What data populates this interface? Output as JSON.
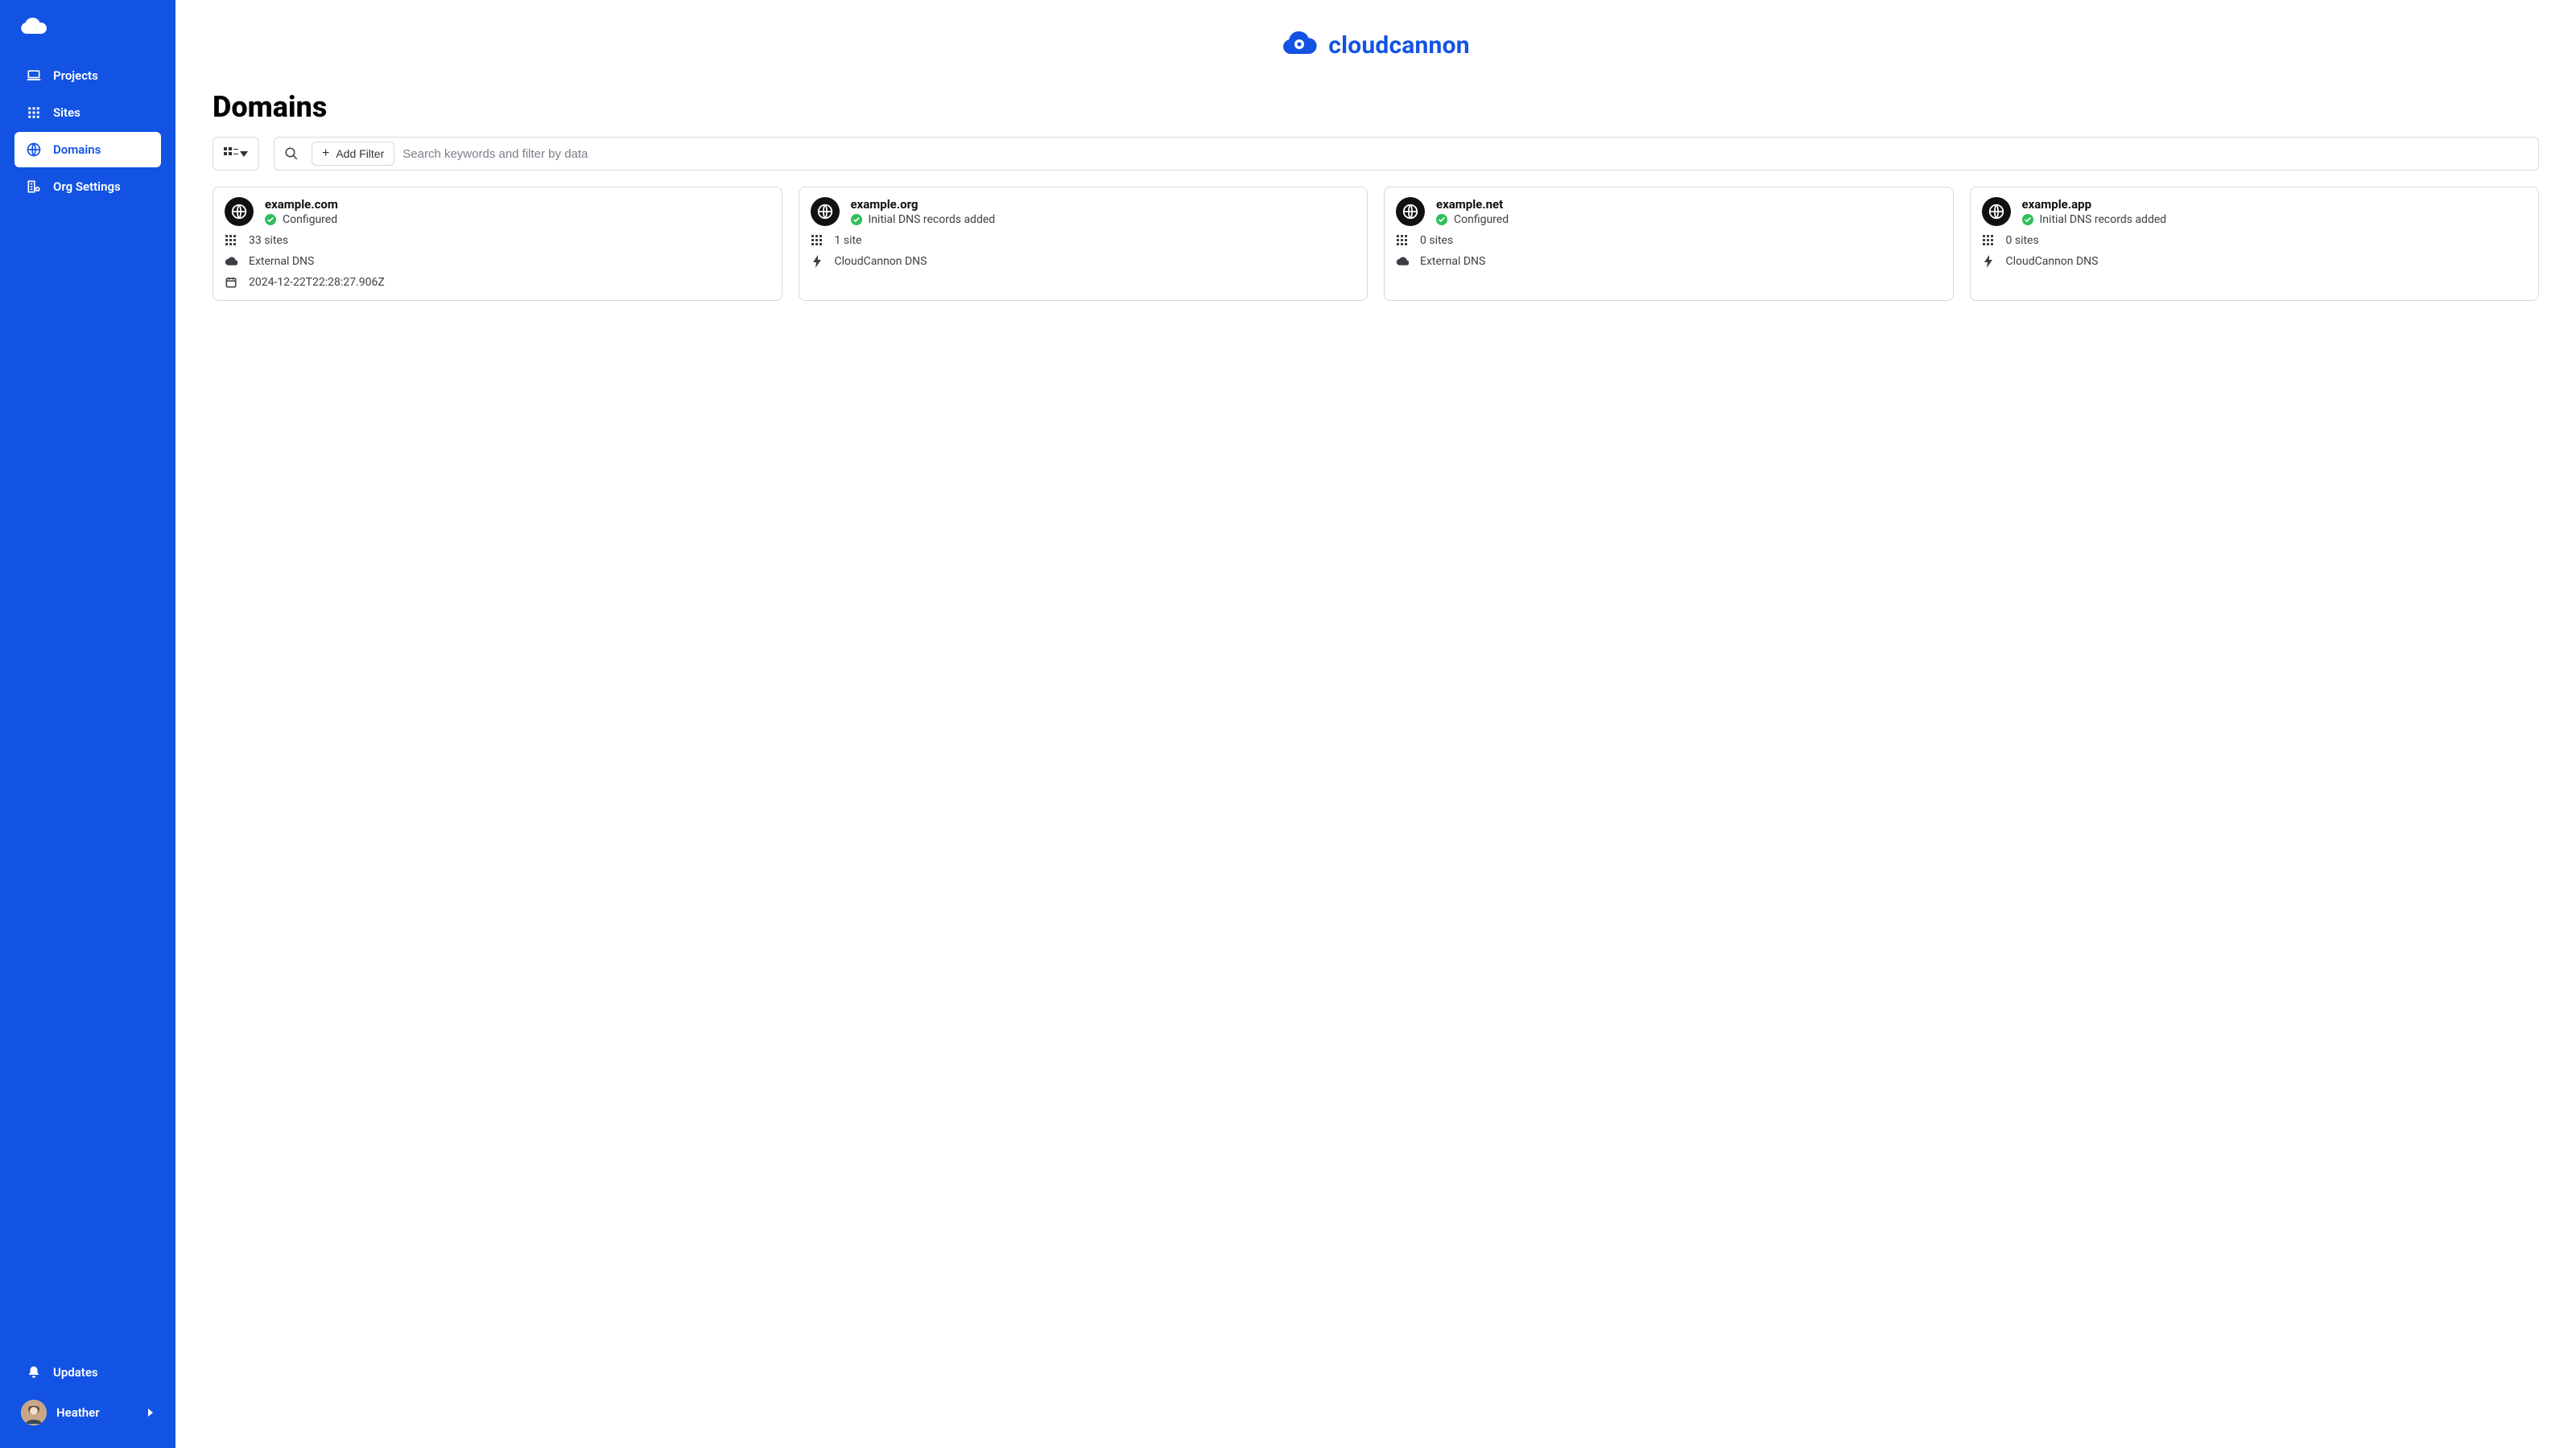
{
  "brand": {
    "name": "cloudcannon"
  },
  "sidebar": {
    "items": [
      {
        "label": "Projects"
      },
      {
        "label": "Sites"
      },
      {
        "label": "Domains"
      },
      {
        "label": "Org Settings"
      }
    ],
    "updates_label": "Updates",
    "user_name": "Heather"
  },
  "page": {
    "title": "Domains"
  },
  "toolbar": {
    "add_filter_label": "Add Filter",
    "search_placeholder": "Search keywords and filter by data"
  },
  "domains": [
    {
      "name": "example.com",
      "status": "Configured",
      "sites": "33 sites",
      "dns": "External DNS",
      "dns_kind": "external",
      "timestamp": "2024-12-22T22:28:27.906Z"
    },
    {
      "name": "example.org",
      "status": "Initial DNS records added",
      "sites": "1 site",
      "dns": "CloudCannon DNS",
      "dns_kind": "cloudcannon"
    },
    {
      "name": "example.net",
      "status": "Configured",
      "sites": "0 sites",
      "dns": "External DNS",
      "dns_kind": "external"
    },
    {
      "name": "example.app",
      "status": "Initial DNS records added",
      "sites": "0 sites",
      "dns": "CloudCannon DNS",
      "dns_kind": "cloudcannon"
    }
  ]
}
